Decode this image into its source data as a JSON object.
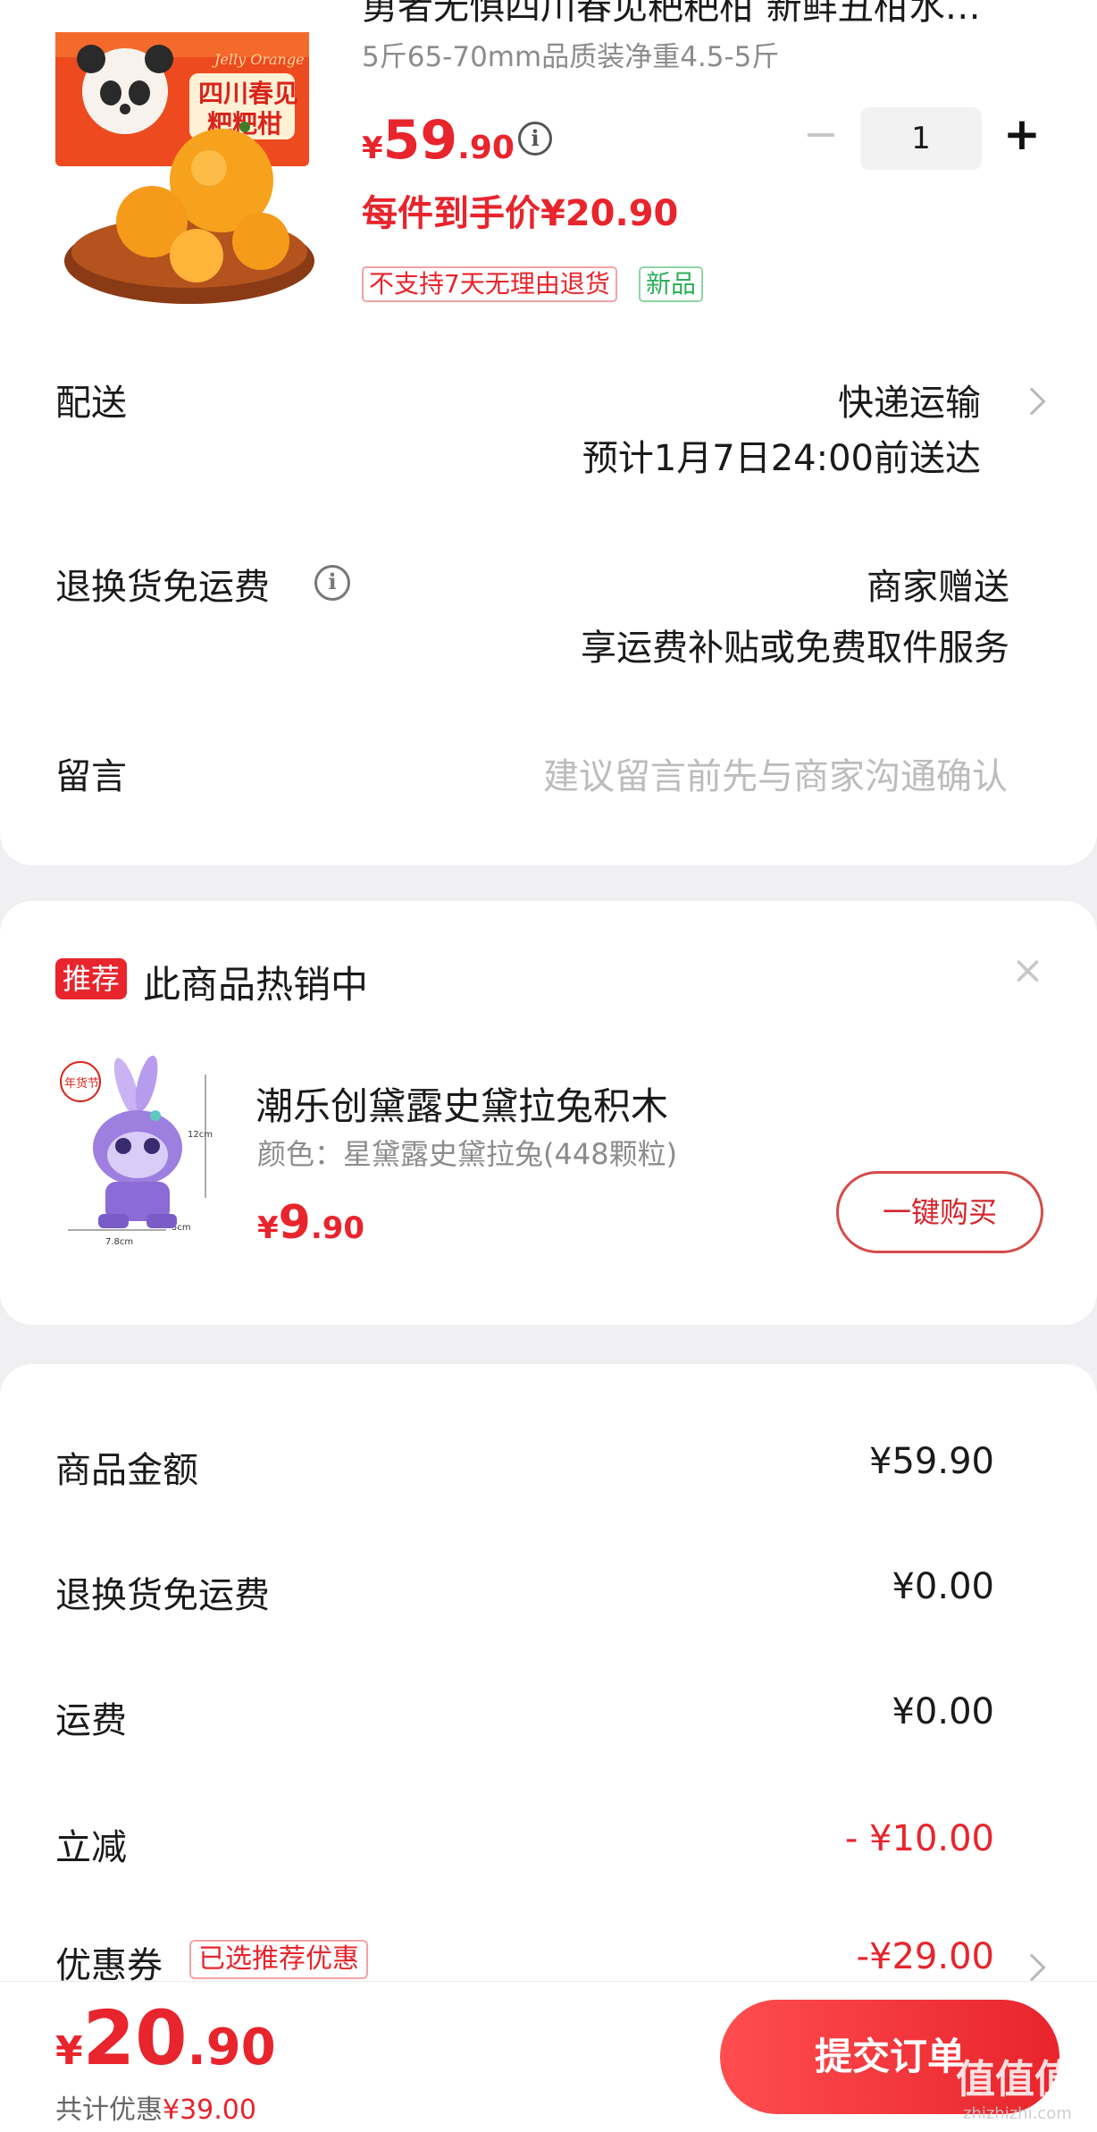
{
  "product": {
    "title": "勇者无惧四川春见粑粑柑 新鲜丑柑水…",
    "spec": "5斤65-70mm品质装净重4.5-5斤",
    "price_symbol": "¥",
    "price_int": "59",
    "price_dec": ".90",
    "info_glyph": "i",
    "quantity": "1",
    "minus_glyph": "−",
    "plus_glyph": "+",
    "final_price_text": "每件到手价¥20.90",
    "tag_return": "不支持7天无理由退货",
    "tag_new": "新品",
    "image_brand_text": "四川春见",
    "image_brand_text2": "粑粑柑",
    "image_script": "Jelly Orange"
  },
  "delivery": {
    "label": "配送",
    "method": "快递运输",
    "eta": "预计1月7日24:00前送达"
  },
  "return_shipping": {
    "label": "退换货免运费",
    "line1": "商家赠送",
    "line2": "享运费补贴或免费取件服务"
  },
  "memo": {
    "label": "留言",
    "placeholder": "建议留言前先与商家沟通确认"
  },
  "recommend": {
    "badge": "推荐",
    "title": "此商品热销中",
    "close_glyph": "×",
    "item_name": "潮乐创黛露史黛拉兔积木",
    "item_spec": "颜色：星黛露史黛拉兔(448颗粒)",
    "price_symbol": "¥",
    "price_int": "9",
    "price_dec": ".90",
    "buy_label": "一键购买",
    "image_logo": "年货节",
    "image_dim_h": "12cm",
    "image_dim_w": "7.8cm",
    "image_dim_d": "5cm"
  },
  "summary": {
    "rows": [
      {
        "label": "商品金额",
        "value": "¥59.90"
      },
      {
        "label": "退换货免运费",
        "value": "¥0.00"
      },
      {
        "label": "运费",
        "value": "¥0.00"
      },
      {
        "label": "立减",
        "value": "- ¥10.00"
      },
      {
        "label": "优惠券",
        "value": "-¥29.00"
      }
    ],
    "coupon_tag": "已选推荐优惠"
  },
  "bottom": {
    "total_symbol": "¥",
    "total_int": "20",
    "total_dec": ".90",
    "saving_label": "共计优惠",
    "saving_value": "¥39.00",
    "submit_label": "提交订单",
    "watermark": "值值值",
    "watermark_sub": "zhizhizhi.com"
  },
  "colors": {
    "accent": "#e8242c",
    "green": "#2daf5a",
    "background": "#f0f0f2"
  }
}
